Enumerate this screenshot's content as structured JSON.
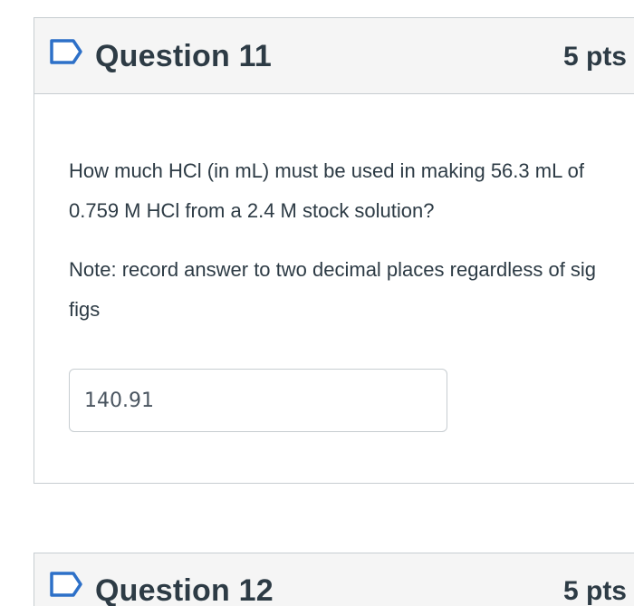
{
  "question_11": {
    "title": "Question 11",
    "points": "5 pts",
    "text": "How much HCl (in mL) must be used in making 56.3 mL of 0.759 M HCl from a 2.4 M stock solution?",
    "note": "Note: record answer to two decimal places regardless of sig figs",
    "answer_value": "140.91",
    "flag_icon": "flag-outline-icon"
  },
  "question_12": {
    "title": "Question 12",
    "points": "5 pts",
    "flag_icon": "flag-outline-icon"
  },
  "colors": {
    "text": "#2d3b45",
    "header_bg": "#f5f5f5",
    "border": "#c7cdd1",
    "flag_stroke": "#2d70c8"
  }
}
